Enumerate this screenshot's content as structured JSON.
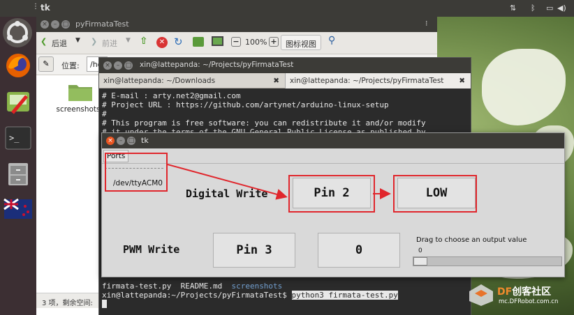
{
  "top_panel": {
    "app_name": "tk",
    "indicators": [
      "network-icon",
      "bluetooth-icon",
      "battery-icon",
      "volume-icon",
      "settings-icon"
    ]
  },
  "nautilus": {
    "title": "pyFirmataTest",
    "toolbar": {
      "back": "后退",
      "forward": "前进",
      "zoom": "100%",
      "view_mode": "图标视图"
    },
    "location_label": "位置:",
    "location_value": "/ho",
    "folder_name": "screenshots",
    "status": "3 项，剩余空间: "
  },
  "terminal": {
    "title": "xin@lattepanda: ~/Projects/pyFirmataTest",
    "tabs": [
      {
        "label": "xin@lattepanda: ~/Downloads"
      },
      {
        "label": "xin@lattepanda: ~/Projects/pyFirmataTest"
      }
    ],
    "lines": [
      "# E-mail : arty.net2@gmail.com",
      "# Project URL : https://github.com/artynet/arduino-linux-setup",
      "#",
      "# This program is free software: you can redistribute it and/or modify",
      "# it under the terms of the GNU General Public License as published by"
    ],
    "ls_files": [
      "firmata-test.py",
      "README.md"
    ],
    "ls_dir": "screenshots",
    "prompt": "xin@lattepanda:~/Projects/pyFirmataTest$",
    "command": "python3 firmata-test.py"
  },
  "tk": {
    "title": "tk",
    "menu_ports": "Ports",
    "menu_item": "/dev/ttyACM0",
    "digital_label": "Digital Write",
    "pin2_button": "Pin 2",
    "low_button": "LOW",
    "pwm_label": "PWM Write",
    "pin3_button": "Pin 3",
    "pwm_value": "0",
    "slider_label": "Drag to choose an output value",
    "slider_value": "0",
    "slider_level": 0
  },
  "watermark": {
    "brand": "DF创客社区",
    "url": "mc.DFRobot.com.cn"
  },
  "colors": {
    "annotation_red": "#e0262c",
    "terminal_bg": "#2b2b2b",
    "panel": "#3c3b37"
  }
}
